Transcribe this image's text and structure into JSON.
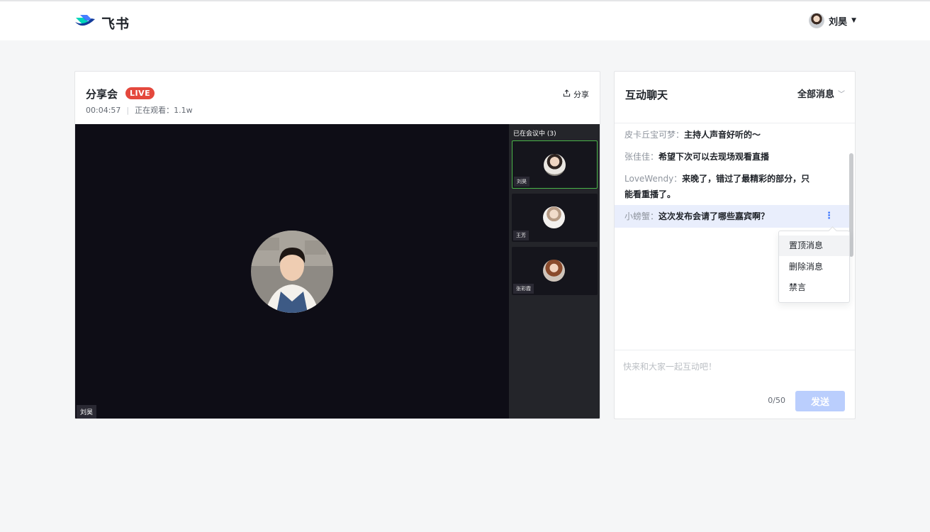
{
  "app": {
    "name": "飞书"
  },
  "user": {
    "name": "刘昊"
  },
  "live": {
    "title": "分享会",
    "badge": "LIVE",
    "elapsed": "00:04:57",
    "viewers_label": "正在观看：1.1w",
    "share_label": "分享",
    "speaker_label": "刘昊"
  },
  "participants": {
    "title": "已在会议中 (3)",
    "items": [
      {
        "name": "刘昊",
        "active": true
      },
      {
        "name": "王芳",
        "active": false
      },
      {
        "name": "张彩霞",
        "active": false
      }
    ]
  },
  "chat": {
    "title": "互动聊天",
    "filter_label": "全部消息",
    "messages": [
      {
        "nick": "皮卡丘宝可梦：",
        "text": "主持人声音好听的～"
      },
      {
        "nick": "张佳佳：",
        "text": "希望下次可以去现场观看直播"
      },
      {
        "nick": "LoveWendy：",
        "text": "来晚了，错过了最精彩的部分，只能看重播了。"
      },
      {
        "nick": "小螃蟹：",
        "text": "这次发布会请了哪些嘉宾啊？"
      }
    ],
    "menu": [
      "置顶消息",
      "删除消息",
      "禁言"
    ],
    "input_placeholder": "快来和大家一起互动吧！",
    "counter": "0/50",
    "send_label": "发送"
  },
  "colors": {
    "live_badge": "#e4483d",
    "active_border": "#49b549",
    "send_button": "#bacefd",
    "hover_row": "#e9eefc",
    "accent": "#3370ff"
  },
  "icons": {
    "logo": "feishu-logo-icon",
    "share": "share-icon",
    "more": "more-vertical-icon",
    "dropdown": "chevron-down-icon"
  }
}
